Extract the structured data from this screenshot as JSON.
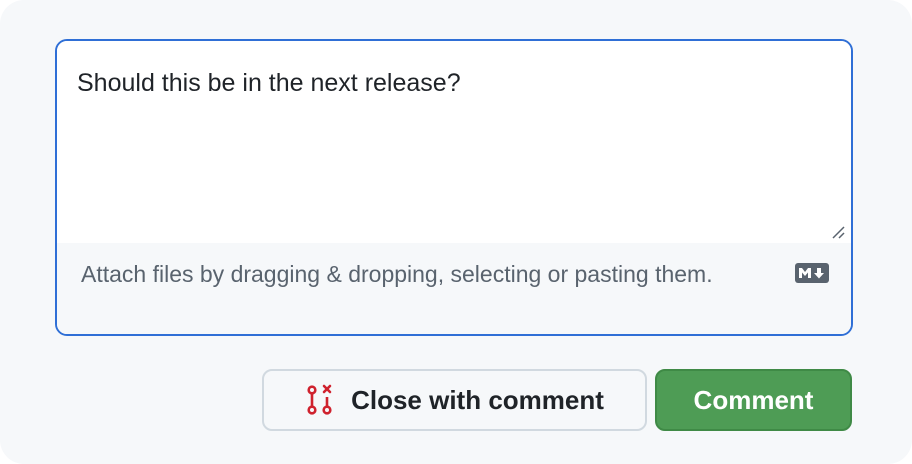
{
  "comment_box": {
    "value": "Should this be in the next release?",
    "attach_hint": "Attach files by dragging & dropping, selecting or pasting them.",
    "markdown_icon": "markdown-icon",
    "resize_icon": "resize-grip-icon"
  },
  "actions": {
    "close_label": "Close with comment",
    "close_icon": "issue-closed-icon",
    "comment_label": "Comment"
  },
  "colors": {
    "focus_border": "#2f6fd6",
    "comment_button": "#4e9c55",
    "close_icon": "#cf222e"
  }
}
